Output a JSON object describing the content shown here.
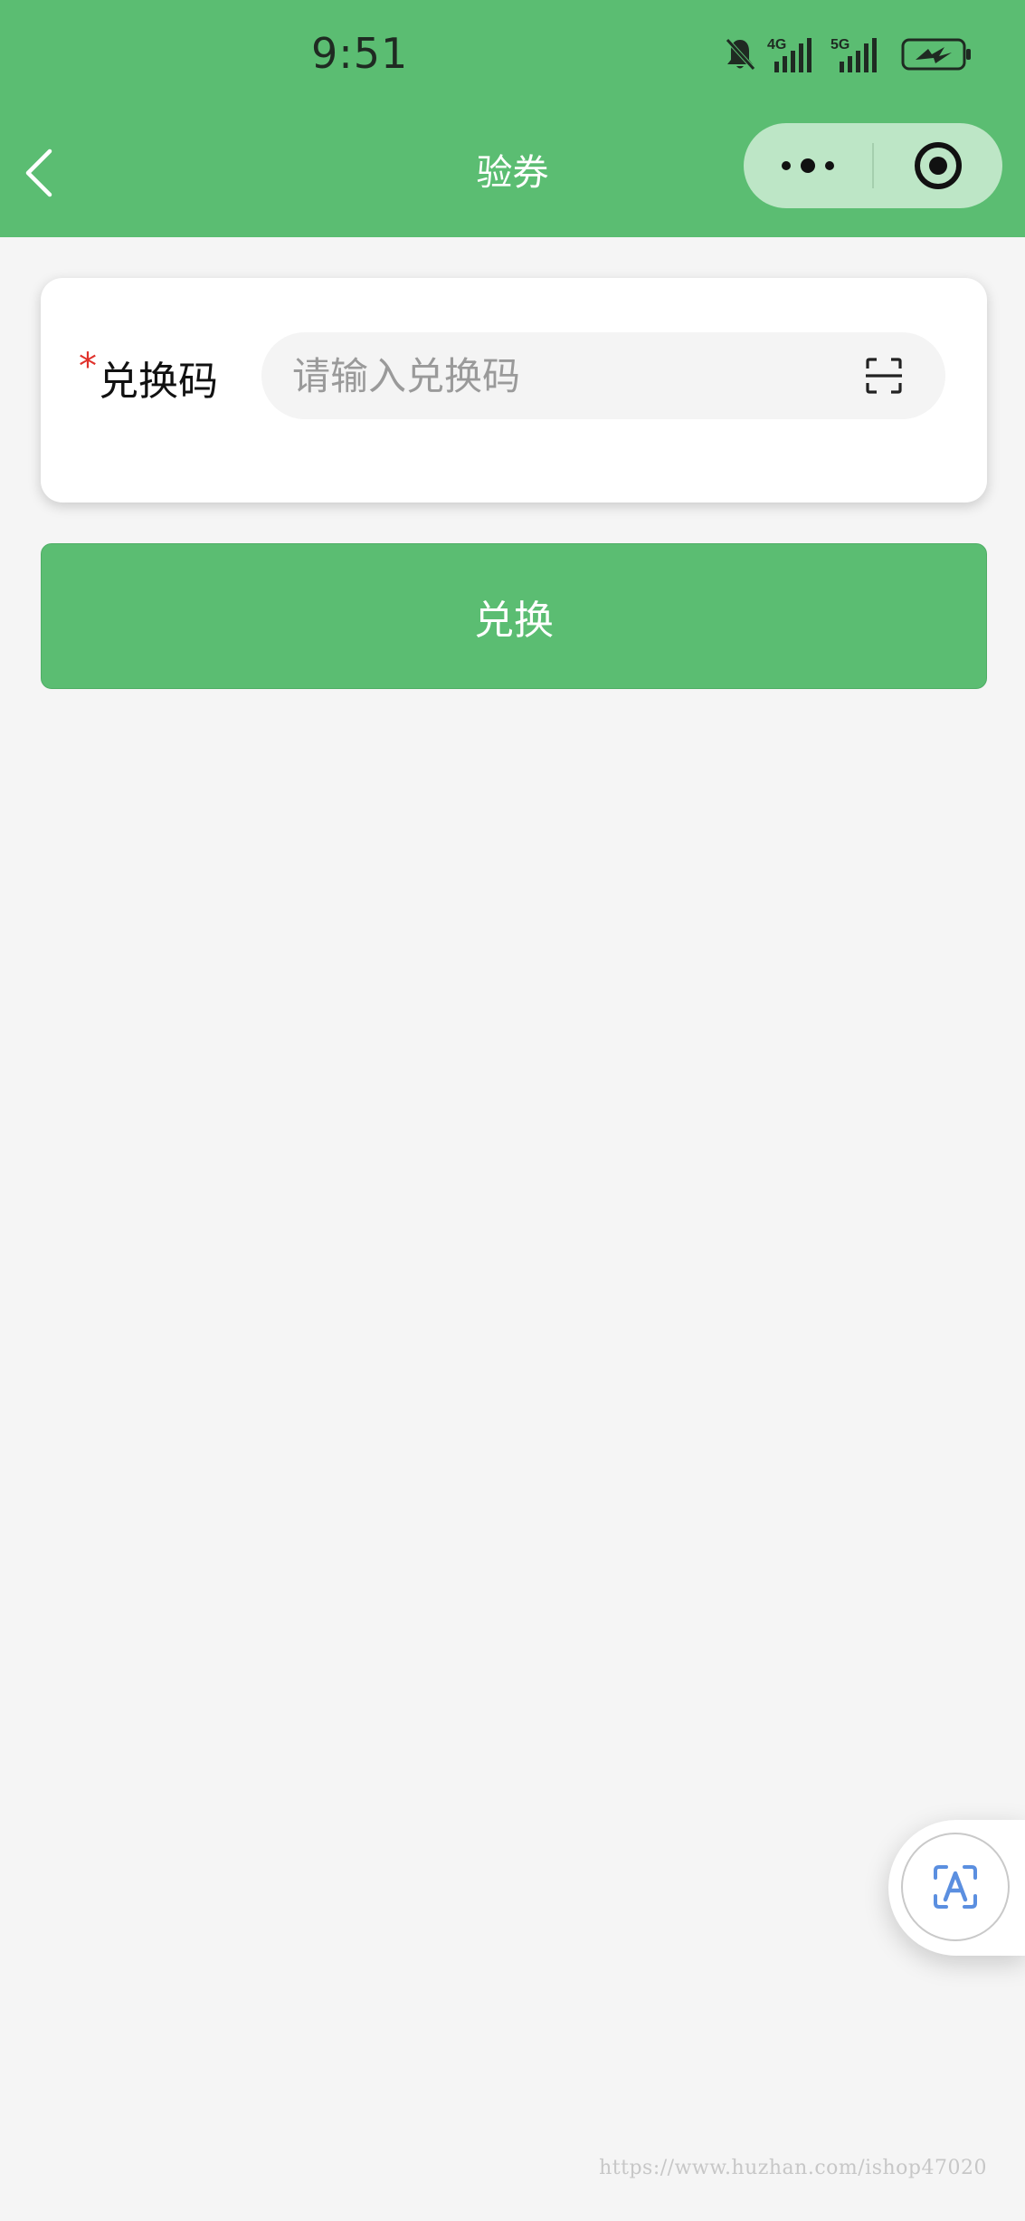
{
  "status_bar": {
    "time": "9:51",
    "signal_1": "4G",
    "signal_2": "5G",
    "icons": [
      "bell-muted-icon",
      "signal-4g-icon",
      "signal-5g-icon",
      "battery-charging-icon"
    ]
  },
  "nav": {
    "title": "验券",
    "back_icon": "chevron-left-icon",
    "menu_icon": "more-dots-icon",
    "close_icon": "target-circle-icon"
  },
  "form": {
    "required_mark": "*",
    "code_label": "兑换码",
    "code_placeholder": "请输入兑换码",
    "code_value": "",
    "scan_icon": "scan-icon"
  },
  "submit": {
    "label": "兑换"
  },
  "floating": {
    "translate_icon": "translate-a-icon"
  },
  "watermark": "https://www.huzhan.com/ishop47020",
  "colors": {
    "brand_green": "#5bbd72",
    "capsule_bg": "#bde6c6",
    "required_red": "#e0312b",
    "page_bg": "#f5f5f5",
    "translate_blue": "#5b8fe0"
  }
}
